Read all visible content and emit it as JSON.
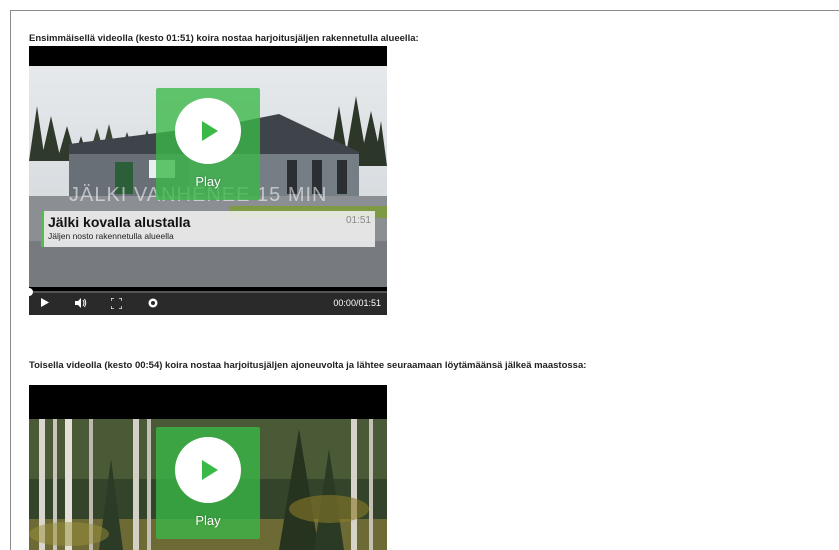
{
  "section1": {
    "caption": "Ensimmäisellä videolla (kesto 01:51) koira nostaa harjoitusjäljen rakennetulla alueella:",
    "video": {
      "play_label": "Play",
      "watermark": "JÄLKI VANHENEE 15 MIN",
      "title": "Jälki kovalla alustalla",
      "subtitle": "Jäljen nosto rakennetulla alueella",
      "duration_badge": "01:51",
      "current_time": "00:00",
      "time_separator": "/",
      "total_time": "01:51",
      "icons": [
        "play-icon",
        "volume-icon",
        "fullscreen-icon",
        "settings-icon"
      ]
    }
  },
  "section2": {
    "caption": "Toisella videolla (kesto 00:54) koira nostaa harjoitusjäljen ajoneuvolta ja lähtee seuraamaan löytämäänsä jälkeä maastossa:",
    "video": {
      "play_label": "Play"
    }
  },
  "colors": {
    "overlay_green": "#3ab948",
    "player_black": "#000000",
    "controls_bg": "#2a2a2a"
  }
}
